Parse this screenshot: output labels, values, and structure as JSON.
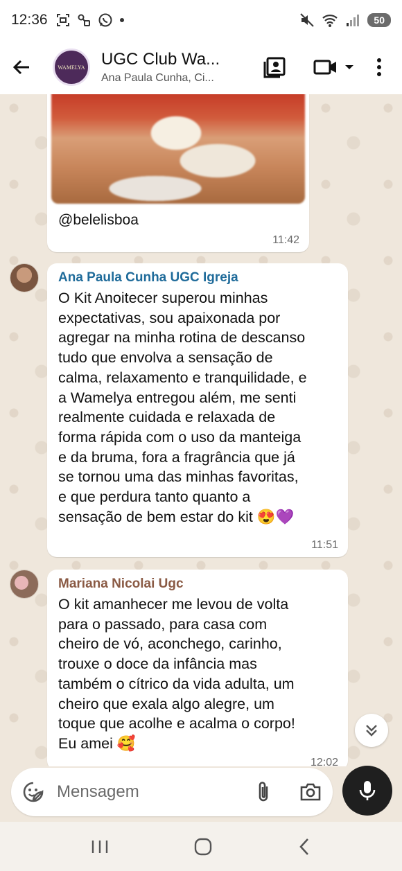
{
  "status_bar": {
    "time": "12:36",
    "battery": "50",
    "icons_left": [
      "screenshot-icon",
      "link-icon",
      "whatsapp-icon",
      "dot-icon"
    ],
    "icons_right": [
      "mute-icon",
      "wifi-icon",
      "signal-icon",
      "battery-icon"
    ]
  },
  "header": {
    "title": "UGC Club Wa...",
    "subtitle": "Ana Paula Cunha, Ci...",
    "avatar_text": "WAMELYA"
  },
  "messages": [
    {
      "type": "image",
      "caption": "@belelisboa",
      "time": "11:42"
    },
    {
      "type": "text",
      "sender": "Ana Paula Cunha UGC Igreja",
      "sender_color": "#1f6b9a",
      "lines": [
        "O Kit Anoitecer superou minhas",
        "expectativas, sou apaixonada por",
        "agregar na minha rotina de descanso",
        "tudo que envolva a sensação de",
        "calma, relaxamento e tranquilidade, e",
        "a Wamelya entregou além, me senti",
        "realmente cuidada e relaxada de",
        "forma rápida com o uso da manteiga",
        "e da bruma, fora a fragrância que já",
        "se tornou uma das minhas favoritas,",
        "e que perdura tanto quanto a",
        "sensação de bem estar do kit 😍💜"
      ],
      "time": "11:51"
    },
    {
      "type": "text",
      "sender": "Mariana Nicolai Ugc",
      "sender_color": "#8a5a44",
      "lines": [
        "O kit amanhecer me levou de volta",
        "para o passado, para casa com",
        "cheiro de vó, aconchego, carinho,",
        "trouxe o doce da infância mas",
        "também o cítrico da vida adulta, um",
        "cheiro que exala algo alegre, um",
        "toque que acolhe e acalma o corpo!",
        "Eu amei 🥰"
      ],
      "time": "12:02"
    }
  ],
  "composer": {
    "placeholder": "Mensagem"
  },
  "colors": {
    "chat_bg": "#efe7dc",
    "bubble": "#ffffff",
    "mic_button": "#1f1f1f"
  }
}
